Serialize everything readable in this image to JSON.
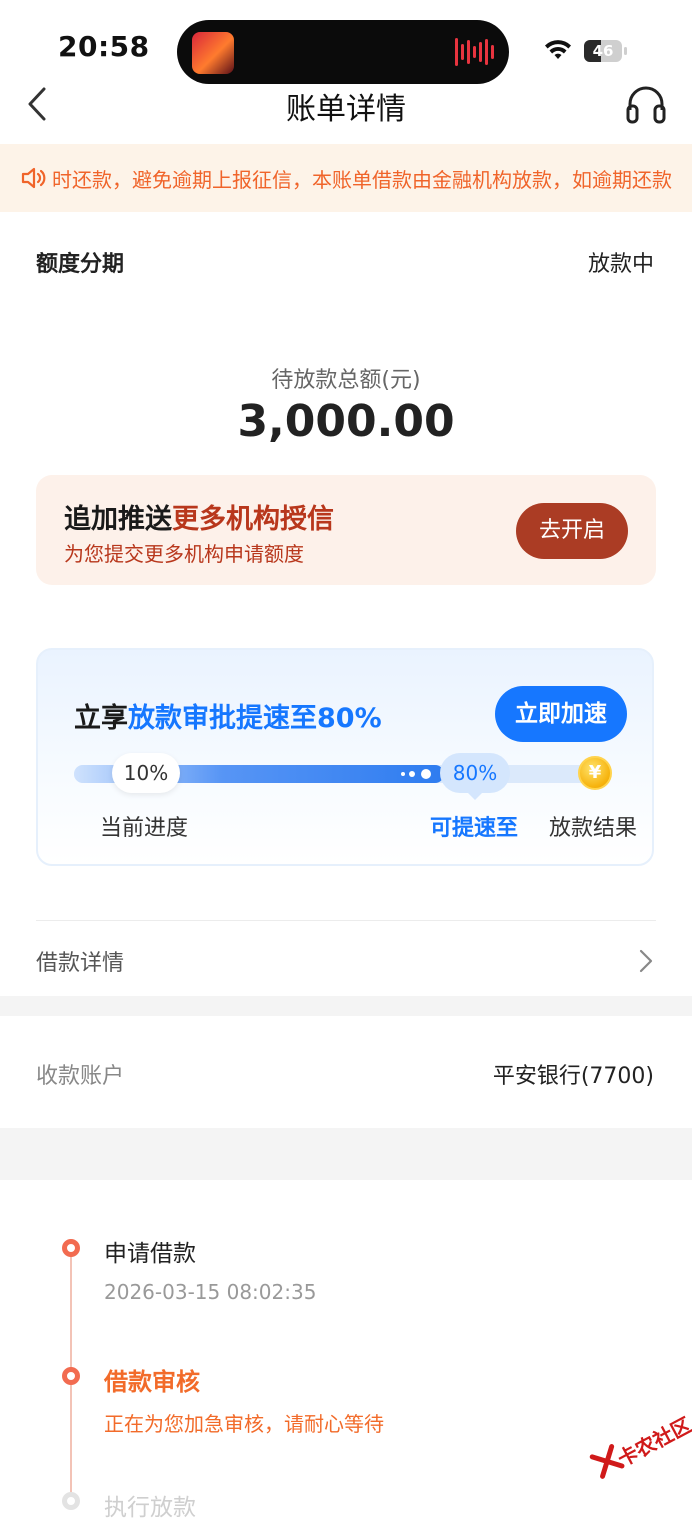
{
  "status_bar": {
    "time": "20:58",
    "battery_level": "46",
    "battery_fraction": 0.46,
    "icons": [
      "now-playing-art",
      "audio-wave-icon",
      "wifi-icon",
      "battery-icon"
    ]
  },
  "nav": {
    "title": "账单详情",
    "back_icon": "chevron-left-icon",
    "support_icon": "headset-icon"
  },
  "notice": {
    "icon": "speaker-icon",
    "text": "时还款，避免逾期上报征信，本账单借款由金融机构放款，如逾期还款"
  },
  "summary": {
    "type": "额度分期",
    "status": "放款中",
    "amount_caption": "待放款总额(元)",
    "amount": "3,000.00"
  },
  "promo": {
    "title_prefix": "追加推送",
    "title_highlight": "更多机构授信",
    "subtitle": "为您提交更多机构申请额度",
    "button": "去开启",
    "colors": {
      "bg": "#fdf1ea",
      "accent": "#b8371c",
      "button": "#ab3c24"
    }
  },
  "speedup": {
    "title_prefix": "立享",
    "title_highlight": "放款审批提速至80%",
    "button": "立即加速",
    "current_percent_label": "10%",
    "target_percent_label": "80%",
    "current_value": 0.1,
    "target_value": 0.8,
    "coin_symbol": "¥",
    "steps": [
      "当前进度",
      "可提速至",
      "放款结果"
    ],
    "colors": {
      "accent": "#1677ff"
    }
  },
  "loan_detail": {
    "label": "借款详情",
    "chevron_icon": "chevron-right-icon"
  },
  "account": {
    "label": "收款账户",
    "value": "平安银行(7700)"
  },
  "timeline": [
    {
      "title": "申请借款",
      "subtitle": "2026-03-15 08:02:35",
      "state": "done"
    },
    {
      "title": "借款审核",
      "subtitle": "正在为您加急审核，请耐心等待",
      "state": "active"
    },
    {
      "title": "执行放款",
      "subtitle": "",
      "state": "pending"
    }
  ],
  "watermark": {
    "text": "卡农社区",
    "color": "#d01a1a"
  }
}
